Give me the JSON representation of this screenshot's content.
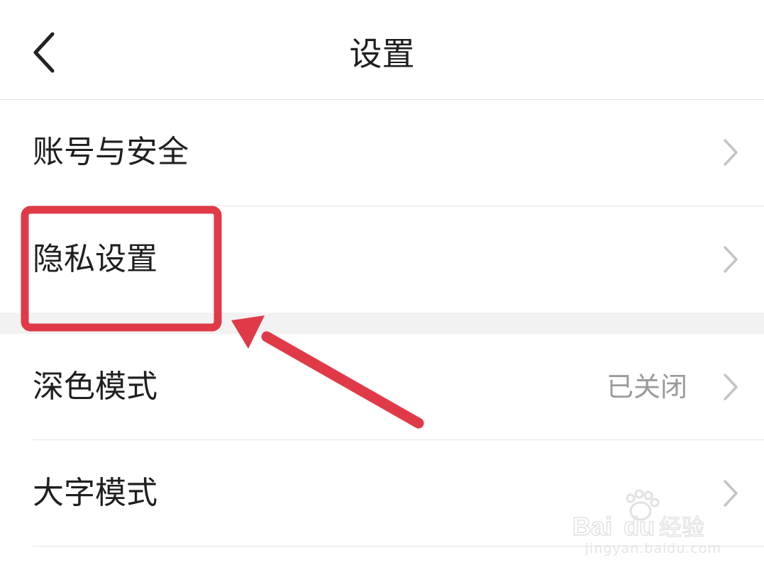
{
  "header": {
    "title": "设置"
  },
  "settings": {
    "rows": [
      {
        "label": "账号与安全"
      },
      {
        "label": "隐私设置"
      },
      {
        "label": "深色模式",
        "value": "已关闭"
      },
      {
        "label": "大字模式"
      }
    ]
  },
  "icons": {
    "back": "chevron-left-icon",
    "row_arrow": "chevron-right-icon"
  },
  "annotation": {
    "highlight_color": "#e03a48",
    "highlighted_row": "隐私设置"
  },
  "watermark": {
    "brand": "Bai",
    "brand2": "du",
    "product": "经验",
    "url": "jingyan.baidu.com"
  }
}
